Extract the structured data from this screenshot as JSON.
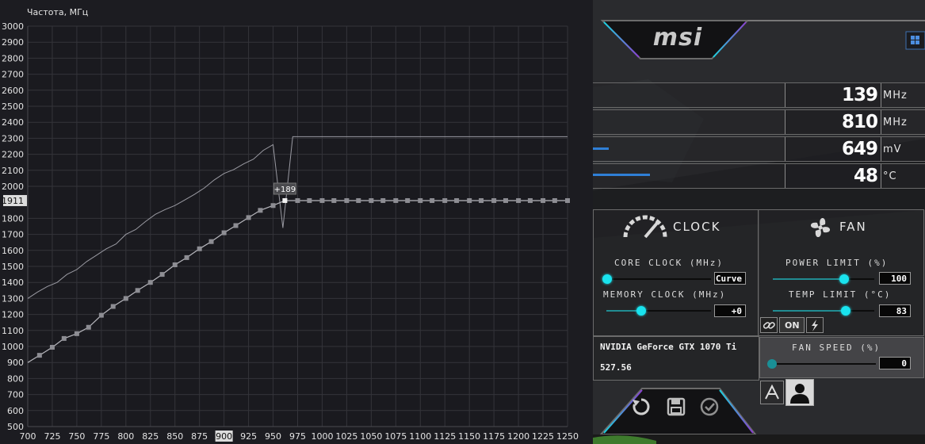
{
  "curve_editor": {
    "title": "Частота, МГц",
    "y_ticks": [
      "3000",
      "2900",
      "2800",
      "2700",
      "2600",
      "2500",
      "2400",
      "2300",
      "2200",
      "2100",
      "2000",
      "1911",
      "1800",
      "1700",
      "1600",
      "1500",
      "1400",
      "1300",
      "1200",
      "1100",
      "1000",
      "900",
      "800",
      "700",
      "600",
      "500"
    ],
    "x_ticks": [
      "700",
      "725",
      "750",
      "775",
      "800",
      "825",
      "850",
      "875",
      "900",
      "925",
      "950",
      "975",
      "1000",
      "1025",
      "1050",
      "1075",
      "1100",
      "1125",
      "1150",
      "1175",
      "1200",
      "1225",
      "1250"
    ],
    "highlight_y": "1911",
    "highlight_x": "900",
    "offset_label": "+189",
    "chart_data": {
      "type": "line",
      "xlabel": "",
      "ylabel": "Частота, МГц",
      "xlim": [
        700,
        1250
      ],
      "ylim": [
        500,
        3000
      ],
      "series": [
        {
          "points": [
            [
              700,
              1300
            ],
            [
              710,
              1340
            ],
            [
              720,
              1375
            ],
            [
              730,
              1400
            ],
            [
              740,
              1450
            ],
            [
              750,
              1480
            ],
            [
              760,
              1530
            ],
            [
              770,
              1570
            ],
            [
              780,
              1610
            ],
            [
              790,
              1640
            ],
            [
              800,
              1700
            ],
            [
              810,
              1730
            ],
            [
              820,
              1780
            ],
            [
              830,
              1825
            ],
            [
              840,
              1855
            ],
            [
              850,
              1880
            ],
            [
              860,
              1915
            ],
            [
              870,
              1950
            ],
            [
              880,
              1990
            ],
            [
              890,
              2040
            ],
            [
              900,
              2080
            ],
            [
              910,
              2105
            ],
            [
              920,
              2140
            ],
            [
              930,
              2170
            ],
            [
              940,
              2225
            ],
            [
              950,
              2260
            ],
            [
              960,
              1740
            ],
            [
              970,
              2310
            ],
            [
              1250,
              2310
            ]
          ]
        },
        {
          "points": [
            [
              700,
              900
            ],
            [
              712,
              945
            ],
            [
              725,
              995
            ],
            [
              737,
              1050
            ],
            [
              750,
              1080
            ],
            [
              762,
              1120
            ],
            [
              775,
              1195
            ],
            [
              787,
              1250
            ],
            [
              800,
              1300
            ],
            [
              812,
              1350
            ],
            [
              825,
              1400
            ],
            [
              837,
              1450
            ],
            [
              850,
              1510
            ],
            [
              862,
              1555
            ],
            [
              875,
              1610
            ],
            [
              887,
              1655
            ],
            [
              900,
              1710
            ],
            [
              912,
              1755
            ],
            [
              925,
              1805
            ],
            [
              937,
              1850
            ],
            [
              950,
              1880
            ],
            [
              962,
              1911
            ],
            [
              975,
              1911
            ],
            [
              987,
              1911
            ],
            [
              1000,
              1911
            ],
            [
              1012,
              1911
            ],
            [
              1025,
              1911
            ],
            [
              1037,
              1911
            ],
            [
              1050,
              1911
            ],
            [
              1062,
              1911
            ],
            [
              1075,
              1911
            ],
            [
              1087,
              1911
            ],
            [
              1100,
              1911
            ],
            [
              1112,
              1911
            ],
            [
              1125,
              1911
            ],
            [
              1137,
              1911
            ],
            [
              1150,
              1911
            ],
            [
              1162,
              1911
            ],
            [
              1175,
              1911
            ],
            [
              1187,
              1911
            ],
            [
              1200,
              1911
            ],
            [
              1212,
              1911
            ],
            [
              1225,
              1911
            ],
            [
              1237,
              1911
            ],
            [
              1250,
              1911
            ]
          ]
        }
      ]
    }
  },
  "afterburner": {
    "brand": "msi",
    "monitor": [
      {
        "value": "139",
        "unit": "MHz"
      },
      {
        "value": "810",
        "unit": "MHz"
      },
      {
        "value": "649",
        "unit": "mV"
      },
      {
        "value": "48",
        "unit": "°C"
      }
    ],
    "clock": {
      "title": "CLOCK",
      "core_label": "CORE CLOCK (MHz)",
      "core_value": "Curve",
      "memory_label": "MEMORY CLOCK (MHz)",
      "memory_value": "+0"
    },
    "fan": {
      "title": "FAN",
      "power_label": "POWER LIMIT (%)",
      "power_value": "100",
      "temp_label": "TEMP LIMIT (°C)",
      "temp_value": "83",
      "speed_label": "FAN SPEED (%)",
      "speed_value": "0",
      "link_label": "ON"
    },
    "gpu_name": "NVIDIA GeForce GTX 1070 Ti",
    "driver_version": "527.56",
    "colors": {
      "accent": "#19e3ee",
      "bar": "#2f7fd6"
    }
  }
}
